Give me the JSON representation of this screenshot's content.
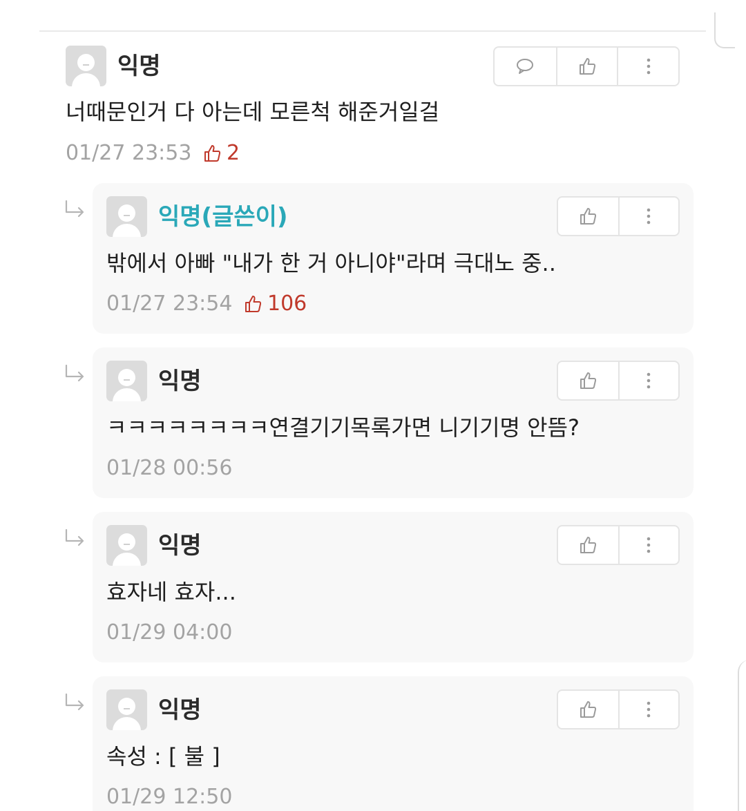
{
  "comments": [
    {
      "author": "익명",
      "text": "너때문인거 다 아는데 모른척 해준거일걸",
      "time": "01/27 23:53",
      "likes": "2"
    }
  ],
  "replies": [
    {
      "author": "익명(글쓴이)",
      "is_op": true,
      "text": "밖에서 아빠 \"내가 한 거 아니야\"라며 극대노 중..",
      "time": "01/27 23:54",
      "likes": "106"
    },
    {
      "author": "익명",
      "is_op": false,
      "text": "ㅋㅋㅋㅋㅋㅋㅋㅋ연결기기목록가면 니기기명 안뜸?",
      "time": "01/28 00:56",
      "likes": ""
    },
    {
      "author": "익명",
      "is_op": false,
      "text": "효자네 효자...",
      "time": "01/29 04:00",
      "likes": ""
    },
    {
      "author": "익명",
      "is_op": false,
      "text": "속성 : [ 불 ]",
      "time": "01/29 12:50",
      "likes": ""
    }
  ],
  "icons": {
    "reply": "speech-bubble-icon",
    "like": "thumbs-up-icon",
    "more": "vertical-dots-icon",
    "reply_indent": "reply-arrow-icon"
  },
  "colors": {
    "op_author": "#2aa8b8",
    "like_count": "#c0392b",
    "meta": "#a3a3a3",
    "reply_bg": "#f8f8f8"
  }
}
